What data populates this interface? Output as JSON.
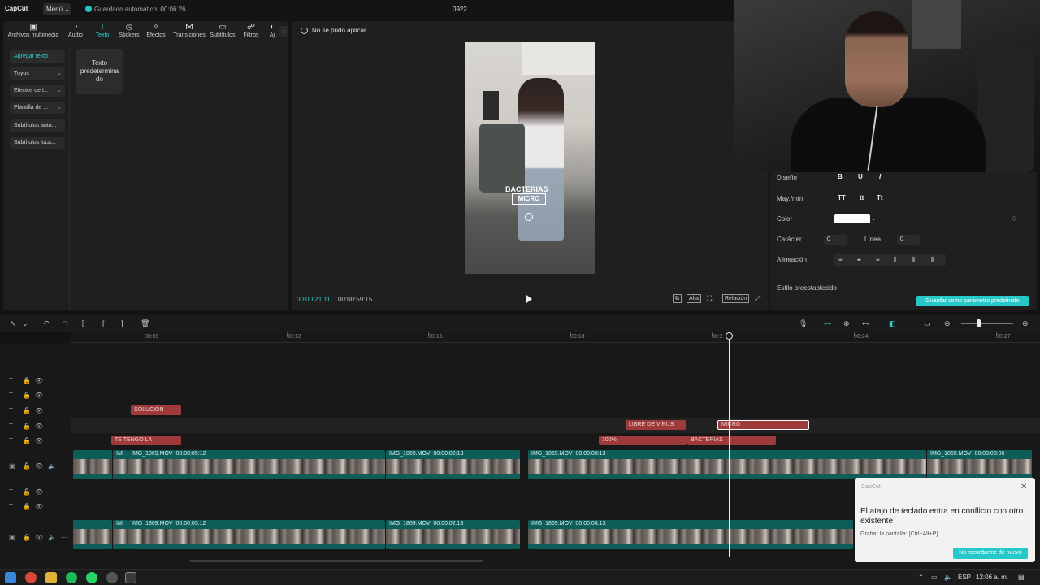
{
  "app": {
    "logo_text": "CapCut",
    "menu_label": "Menú ⌄",
    "autosave_text": "Guardado automático: 00:06:26",
    "project_title": "0922"
  },
  "media_tabs": [
    {
      "label": "Archivos multimedia",
      "icon": "media-icon"
    },
    {
      "label": "Audio",
      "icon": "audio-icon"
    },
    {
      "label": "Texto",
      "icon": "text-icon",
      "active": true
    },
    {
      "label": "Stickers",
      "icon": "sticker-icon"
    },
    {
      "label": "Efectos",
      "icon": "effects-icon"
    },
    {
      "label": "Transiciones",
      "icon": "transitions-icon"
    },
    {
      "label": "Subtítulos",
      "icon": "subtitles-icon"
    },
    {
      "label": "Filtros",
      "icon": "filters-icon"
    },
    {
      "label": "Aj",
      "icon": "adjust-icon"
    }
  ],
  "sidebar": [
    {
      "label": "Agregar texto",
      "active": true
    },
    {
      "label": "Tuyos"
    },
    {
      "label": "Efectos de t..."
    },
    {
      "label": "Plantilla de ..."
    },
    {
      "label": "Subtítulos auto..."
    },
    {
      "label": "Subtítulos loca..."
    }
  ],
  "text_tile": "Texto predetermina do",
  "preview": {
    "status": "No se pudo aplicar ...",
    "overlay_line1": "BACTERIAS",
    "overlay_line2": "MICRO",
    "time_current": "00:00:21:11",
    "time_total": "00:00:59:15",
    "ratio_label": "Relación",
    "quality_label": "Alta"
  },
  "properties": {
    "design_label": "Diseño",
    "case_label": "May./mín.",
    "color_label": "Color",
    "char_label": "Carácter",
    "char_value": "0",
    "line_label": "Línea",
    "line_value": "0",
    "align_label": "Alineación",
    "preset_label": "Estilo preestablecido",
    "save_preset_button": "Guardar como parámetro predefinido",
    "bold": "B",
    "underline": "U",
    "italic": "I",
    "case_upper": "TT",
    "case_lower": "tt",
    "case_title": "Tt",
    "swatch_color": "#ffffff"
  },
  "ruler": [
    "00:09",
    "00:12",
    "00:15",
    "00:18",
    "00:2",
    "00:24",
    "00:27"
  ],
  "text_clips": [
    {
      "label": "SOLUCIÓN"
    },
    {
      "label": "LIBRE DE VIRUS"
    },
    {
      "label": "MICRO",
      "selected": true
    },
    {
      "label": "TE TENGO LA"
    },
    {
      "label": "100%"
    },
    {
      "label": "BACTERIAS"
    }
  ],
  "video_clips": [
    {
      "name": "IM",
      "duration": ""
    },
    {
      "name": "IMG_1869.MOV",
      "duration": "00:00:05:12"
    },
    {
      "name": "IMG_1869.MOV",
      "duration": "00:00:02:13"
    },
    {
      "name": "IMG_1869.MOV",
      "duration": "00:00:08:13"
    },
    {
      "name": "IMG_1869.MOV",
      "duration": "00:00:08:06"
    }
  ],
  "toast": {
    "app_name": "CapCut",
    "title": "El atajo de teclado entra en conflicto con otro existente",
    "subtitle": "Grabar la pantalla: [Ctrl+Alt+P]",
    "button": "No recordarme de nuevo"
  },
  "taskbar": {
    "lang": "ESP",
    "time": "12:06 a. m."
  },
  "colors": {
    "accent": "#2ad1d1",
    "text_clip": "#9e3a3a",
    "video_track": "#0f5d59"
  }
}
